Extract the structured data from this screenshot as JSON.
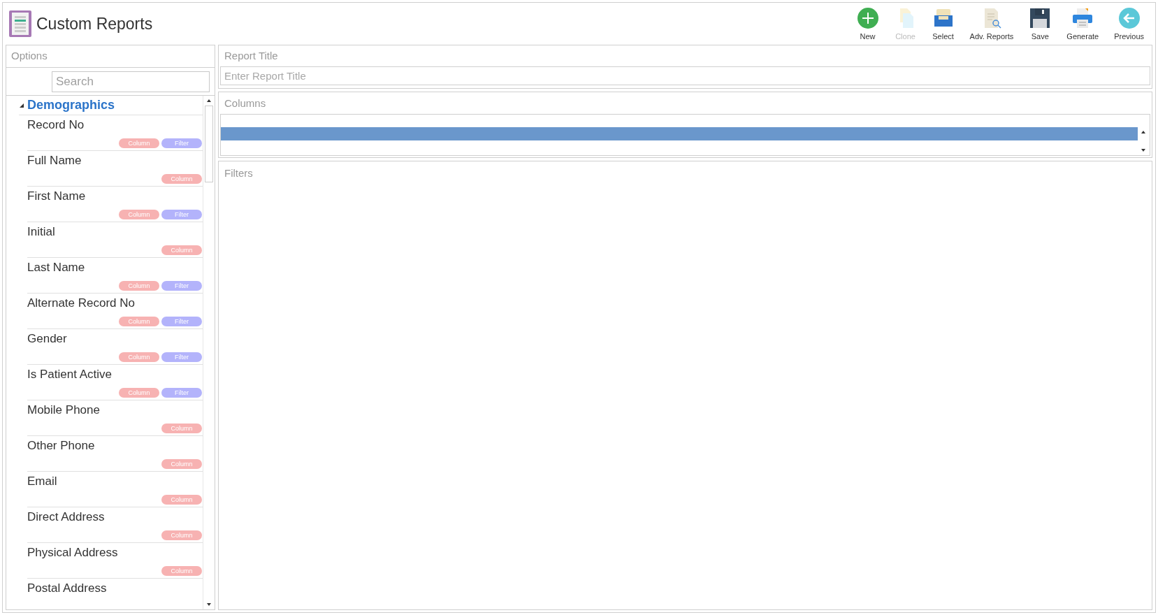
{
  "app_title": "Custom Reports",
  "toolbar": [
    {
      "kind": "new",
      "label": "New",
      "disabled": false
    },
    {
      "kind": "clone",
      "label": "Clone",
      "disabled": true
    },
    {
      "kind": "select",
      "label": "Select",
      "disabled": false
    },
    {
      "kind": "adv",
      "label": "Adv. Reports",
      "disabled": false
    },
    {
      "kind": "save",
      "label": "Save",
      "disabled": false
    },
    {
      "kind": "generate",
      "label": "Generate",
      "disabled": false
    },
    {
      "kind": "previous",
      "label": "Previous",
      "disabled": false
    }
  ],
  "options": {
    "title": "Options",
    "search": {
      "placeholder": "Search"
    },
    "groups": [
      {
        "label": "Demographics",
        "expanded": true,
        "children": [
          {
            "label": "Record No",
            "tags": [
              {
                "kind": "column",
                "label": "Column"
              },
              {
                "kind": "filter",
                "label": "Filter"
              }
            ]
          },
          {
            "label": "Full Name",
            "tags": [
              {
                "kind": "column",
                "label": "Column"
              }
            ]
          },
          {
            "label": "First Name",
            "tags": [
              {
                "kind": "column",
                "label": "Column"
              },
              {
                "kind": "filter",
                "label": "Filter"
              }
            ]
          },
          {
            "label": "Initial",
            "tags": [
              {
                "kind": "column",
                "label": "Column"
              }
            ]
          },
          {
            "label": "Last Name",
            "tags": [
              {
                "kind": "column",
                "label": "Column"
              },
              {
                "kind": "filter",
                "label": "Filter"
              }
            ]
          },
          {
            "label": "Alternate Record No",
            "tags": [
              {
                "kind": "column",
                "label": "Column"
              },
              {
                "kind": "filter",
                "label": "Filter"
              }
            ]
          },
          {
            "label": "Gender",
            "tags": [
              {
                "kind": "column",
                "label": "Column"
              },
              {
                "kind": "filter",
                "label": "Filter"
              }
            ]
          },
          {
            "label": "Is Patient Active",
            "tags": [
              {
                "kind": "column",
                "label": "Column"
              },
              {
                "kind": "filter",
                "label": "Filter"
              }
            ]
          },
          {
            "label": "Mobile Phone",
            "tags": [
              {
                "kind": "column",
                "label": "Column"
              }
            ]
          },
          {
            "label": "Other Phone",
            "tags": [
              {
                "kind": "column",
                "label": "Column"
              }
            ]
          },
          {
            "label": "Email",
            "tags": [
              {
                "kind": "column",
                "label": "Column"
              }
            ]
          },
          {
            "label": "Direct Address",
            "tags": [
              {
                "kind": "column",
                "label": "Column"
              }
            ]
          },
          {
            "label": "Physical Address",
            "tags": [
              {
                "kind": "column",
                "label": "Column"
              }
            ]
          },
          {
            "label": "Postal Address"
          }
        ]
      }
    ]
  },
  "report_title": {
    "label": "Report Title",
    "placeholder": "Enter Report Title"
  },
  "columns": {
    "label": "Columns",
    "rows": [
      {
        "selected": true
      }
    ]
  },
  "filters": {
    "label": "Filters"
  }
}
